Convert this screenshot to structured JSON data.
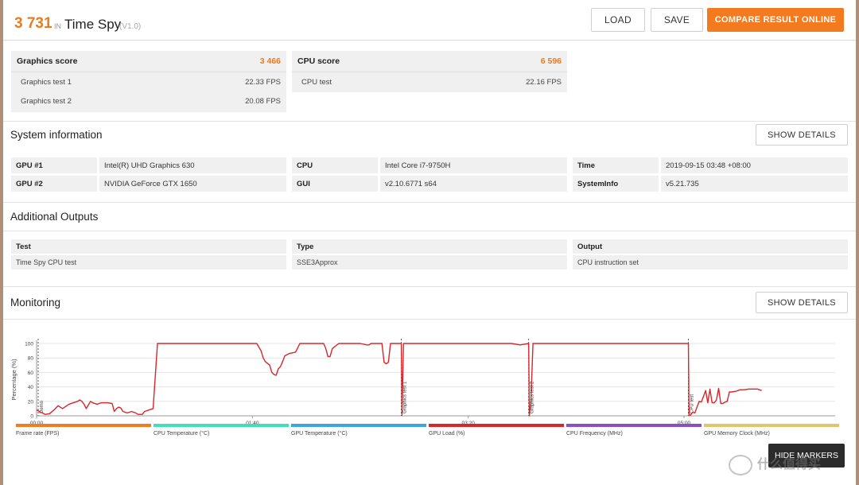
{
  "header": {
    "score": "3 731",
    "in_label": "IN",
    "benchmark": "Time Spy",
    "version": "(V1.0)",
    "load_label": "LOAD",
    "save_label": "SAVE",
    "compare_label": "COMPARE RESULT ONLINE"
  },
  "graphics": {
    "label": "Graphics score",
    "value": "3 466",
    "tests": [
      {
        "name": "Graphics test 1",
        "value": "22.33 FPS"
      },
      {
        "name": "Graphics test 2",
        "value": "20.08 FPS"
      }
    ]
  },
  "cpu": {
    "label": "CPU score",
    "value": "6 596",
    "tests": [
      {
        "name": "CPU test",
        "value": "22.16 FPS"
      }
    ]
  },
  "system_info": {
    "title": "System information",
    "details_label": "SHOW DETAILS",
    "rows": [
      [
        {
          "key": "GPU #1",
          "value": "Intel(R) UHD Graphics 630"
        },
        {
          "key": "CPU",
          "value": "Intel Core i7-9750H"
        },
        {
          "key": "Time",
          "value": "2019-09-15 03:48 +08:00"
        }
      ],
      [
        {
          "key": "GPU #2",
          "value": "NVIDIA GeForce GTX 1650"
        },
        {
          "key": "GUI",
          "value": "v2.10.6771 s64"
        },
        {
          "key": "SystemInfo",
          "value": "v5.21.735"
        }
      ]
    ]
  },
  "additional_outputs": {
    "title": "Additional Outputs",
    "columns": [
      "Test",
      "Type",
      "Output"
    ],
    "values": [
      "Time Spy CPU test",
      "SSE3Approx",
      "CPU instruction set"
    ]
  },
  "monitoring": {
    "title": "Monitoring",
    "details_label": "SHOW DETAILS",
    "hide_markers_label": "HIDE MARKERS",
    "legend": [
      {
        "label": "Frame rate (FPS)",
        "color": "#f07d22"
      },
      {
        "label": "CPU Temperature (°C)",
        "color": "#3de0b8"
      },
      {
        "label": "GPU Temperature (°C)",
        "color": "#3aa7e3"
      },
      {
        "label": "GPU Load (%)",
        "color": "#d8262b"
      },
      {
        "label": "CPU Frequency (MHz)",
        "color": "#8a4fc6"
      },
      {
        "label": "GPU Memory Clock (MHz)",
        "color": "#e2c46e"
      }
    ]
  },
  "chart_data": {
    "type": "line",
    "title": "",
    "ylabel": "Percentage (%)",
    "xlabel": "",
    "ylim": [
      0,
      100
    ],
    "yticks": [
      0,
      20,
      40,
      60,
      80,
      100
    ],
    "xlim_seconds": [
      0,
      370
    ],
    "xticks": [
      "00:00",
      "01:40",
      "03:20",
      "05:00"
    ],
    "markers": [
      {
        "label": "Demo",
        "t": 0
      },
      {
        "label": "Graphics test 1",
        "t": 169
      },
      {
        "label": "Graphics test 2",
        "t": 228
      },
      {
        "label": "CPU test",
        "t": 302
      }
    ],
    "series": [
      {
        "name": "GPU Load (%)",
        "color": "#d8262b",
        "points": [
          [
            0,
            8
          ],
          [
            4,
            2
          ],
          [
            6,
            3
          ],
          [
            8,
            8
          ],
          [
            10,
            14
          ],
          [
            12,
            10
          ],
          [
            13,
            12
          ],
          [
            15,
            16
          ],
          [
            17,
            18
          ],
          [
            19,
            20
          ],
          [
            20,
            22
          ],
          [
            21,
            20
          ],
          [
            22,
            16
          ],
          [
            23,
            10
          ],
          [
            25,
            20
          ],
          [
            26,
            18
          ],
          [
            28,
            16
          ],
          [
            30,
            18
          ],
          [
            33,
            18
          ],
          [
            35,
            17
          ],
          [
            36,
            6
          ],
          [
            37,
            10
          ],
          [
            38,
            12
          ],
          [
            39,
            11
          ],
          [
            40,
            6
          ],
          [
            42,
            4
          ],
          [
            44,
            6
          ],
          [
            46,
            4
          ],
          [
            47,
            2
          ],
          [
            48,
            2
          ],
          [
            49,
            2
          ],
          [
            50,
            6
          ],
          [
            52,
            8
          ],
          [
            54,
            10
          ],
          [
            56,
            100
          ],
          [
            60,
            100
          ],
          [
            90,
            100
          ],
          [
            95,
            100
          ],
          [
            100,
            100
          ],
          [
            102,
            100
          ],
          [
            104,
            90
          ],
          [
            105,
            80
          ],
          [
            106,
            75
          ],
          [
            108,
            70
          ],
          [
            109,
            60
          ],
          [
            110,
            57
          ],
          [
            111,
            56
          ],
          [
            112,
            65
          ],
          [
            113,
            68
          ],
          [
            114,
            75
          ],
          [
            115,
            83
          ],
          [
            117,
            86
          ],
          [
            120,
            88
          ],
          [
            122,
            100
          ],
          [
            125,
            100
          ],
          [
            128,
            100
          ],
          [
            130,
            100
          ],
          [
            133,
            100
          ],
          [
            134,
            93
          ],
          [
            135,
            82
          ],
          [
            136,
            82
          ],
          [
            137,
            93
          ],
          [
            140,
            100
          ],
          [
            145,
            100
          ],
          [
            150,
            100
          ],
          [
            153,
            98
          ],
          [
            154,
            98
          ],
          [
            155,
            100
          ],
          [
            158,
            100
          ],
          [
            160,
            100
          ],
          [
            161,
            74
          ],
          [
            162,
            72
          ],
          [
            163,
            74
          ],
          [
            164,
            100
          ],
          [
            166,
            100
          ],
          [
            169,
            100
          ],
          [
            169.3,
            1
          ],
          [
            170,
            100
          ],
          [
            175,
            100
          ],
          [
            180,
            100
          ],
          [
            190,
            100
          ],
          [
            200,
            100
          ],
          [
            210,
            100
          ],
          [
            220,
            100
          ],
          [
            224,
            98
          ],
          [
            226,
            99
          ],
          [
            228,
            100
          ],
          [
            228.3,
            0
          ],
          [
            229,
            18
          ],
          [
            230,
            100
          ],
          [
            235,
            100
          ],
          [
            245,
            100
          ],
          [
            260,
            100
          ],
          [
            280,
            100
          ],
          [
            295,
            100
          ],
          [
            302,
            100
          ],
          [
            302.3,
            1
          ],
          [
            303,
            1
          ],
          [
            304,
            5
          ],
          [
            305,
            4
          ],
          [
            306,
            12
          ],
          [
            307,
            20
          ],
          [
            308,
            19
          ],
          [
            309,
            27
          ],
          [
            310,
            35
          ],
          [
            311,
            18
          ],
          [
            312,
            37
          ],
          [
            313,
            18
          ],
          [
            314,
            18
          ],
          [
            315,
            22
          ],
          [
            316,
            38
          ],
          [
            317,
            17
          ],
          [
            318,
            17
          ],
          [
            319,
            19
          ],
          [
            320,
            20
          ],
          [
            321,
            33
          ],
          [
            322,
            33
          ],
          [
            324,
            34
          ],
          [
            326,
            36
          ],
          [
            328,
            36
          ],
          [
            330,
            37
          ],
          [
            332,
            37
          ],
          [
            334,
            37
          ],
          [
            336,
            35
          ]
        ]
      }
    ]
  },
  "watermark": "什么值得买"
}
